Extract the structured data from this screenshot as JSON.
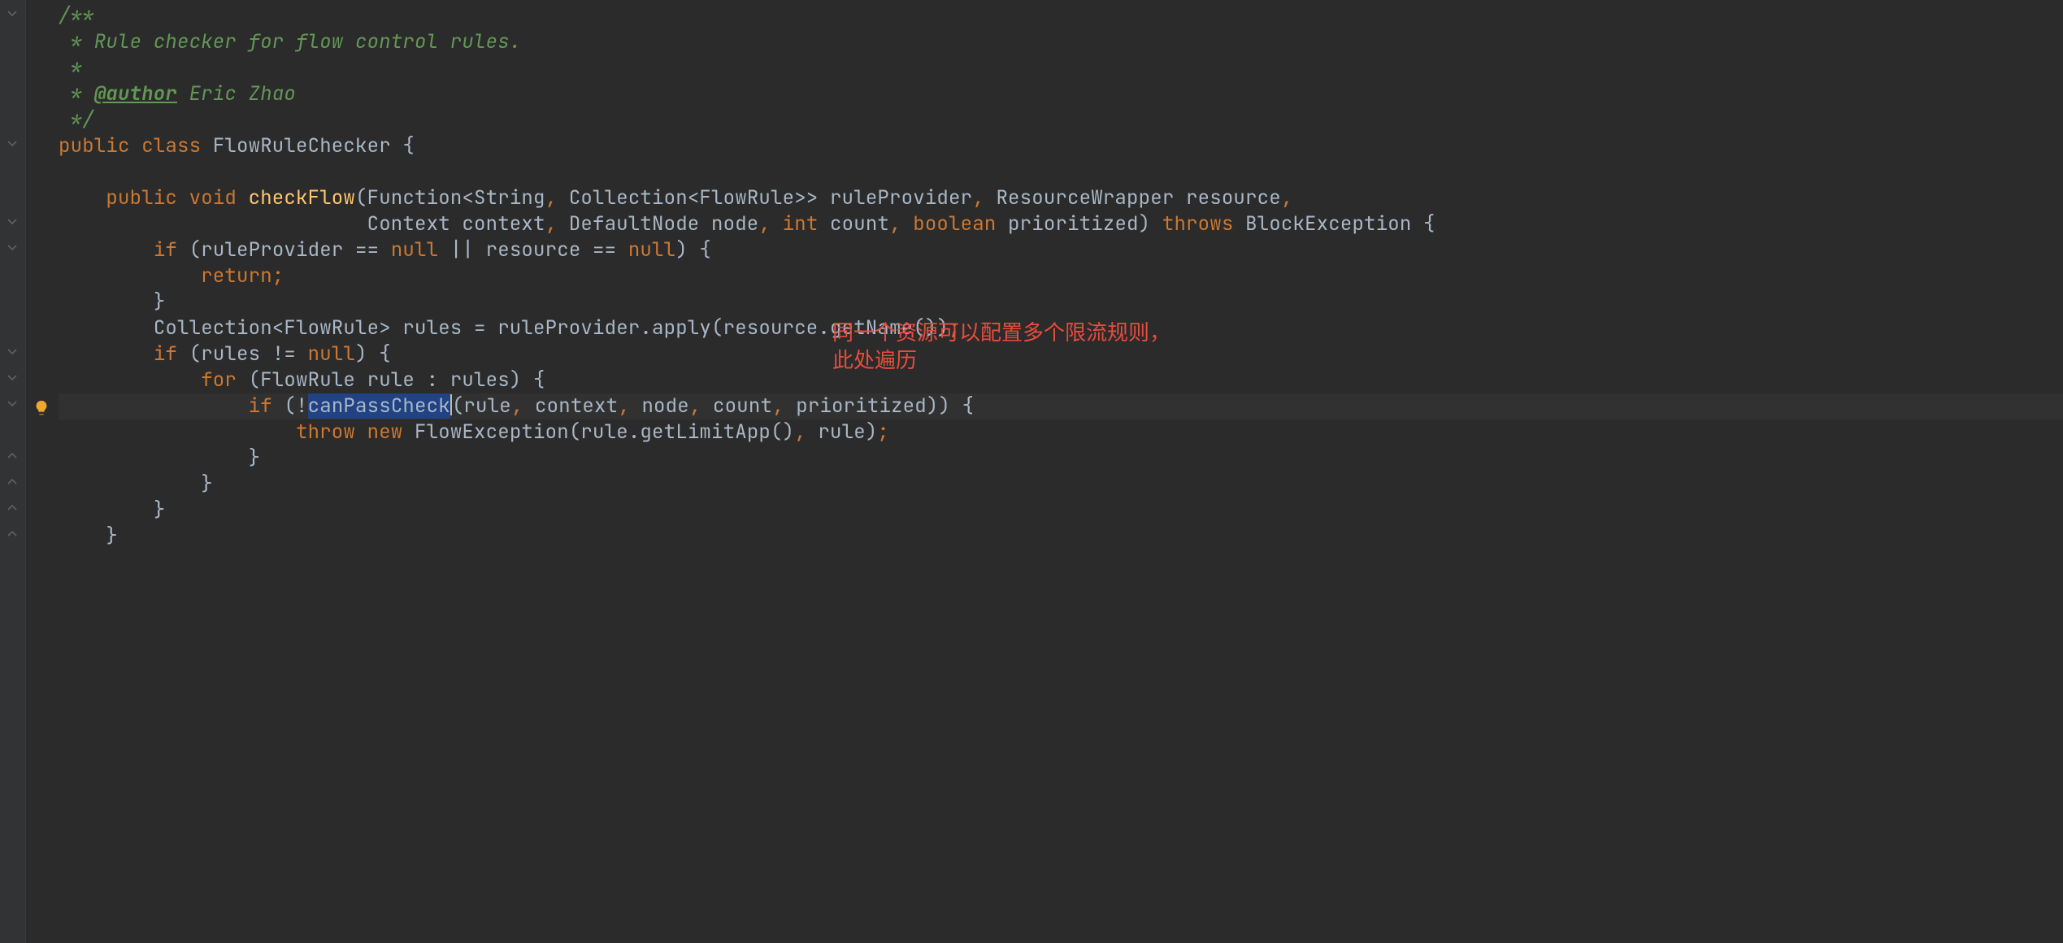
{
  "code": {
    "l1": "/**",
    "l2": " * Rule checker for flow control rules.",
    "l3": " *",
    "l4_pre": " * ",
    "l4_tag": "@author",
    "l4_post": " Eric Zhao",
    "l5": " */",
    "l6_kw1": "public ",
    "l6_kw2": "class ",
    "l6_name": "FlowRuleChecker ",
    "l6_brace": "{",
    "l7": "",
    "l8_ind": "    ",
    "l8_kw1": "public ",
    "l8_kw2": "void ",
    "l8_meth": "checkFlow",
    "l8_sig": "(Function<String",
    "l8_c1": ", ",
    "l8_sig2": "Collection<FlowRule>> ruleProvider",
    "l8_c2": ", ",
    "l8_sig3": "ResourceWrapper resource",
    "l8_c3": ",",
    "l9_ind": "                          ",
    "l9_a": "Context context",
    "l9_c1": ", ",
    "l9_b": "DefaultNode node",
    "l9_c2": ", ",
    "l9_kw1": "int ",
    "l9_c": "count",
    "l9_c3": ", ",
    "l9_kw2": "boolean ",
    "l9_d": "prioritized) ",
    "l9_kw3": "throws ",
    "l9_e": "BlockException {",
    "l10_ind": "        ",
    "l10_kw": "if ",
    "l10_a": "(ruleProvider == ",
    "l10_kw2": "null ",
    "l10_b": "|| resource == ",
    "l10_kw3": "null",
    "l10_c": ") {",
    "l11_ind": "            ",
    "l11_kw": "return;",
    "l12_ind": "        ",
    "l12_a": "}",
    "l13_ind": "        ",
    "l13_a": "Collection<FlowRule> rules = ruleProvider.apply(resource.getName())",
    "l13_semi": ";",
    "l14_ind": "        ",
    "l14_kw": "if ",
    "l14_a": "(rules != ",
    "l14_kw2": "null",
    "l14_b": ") {",
    "l15_ind": "            ",
    "l15_kw": "for ",
    "l15_a": "(FlowRule rule : rules) {",
    "l16_ind": "                ",
    "l16_kw": "if ",
    "l16_a": "(!",
    "l16_sel": "canPassCheck",
    "l16_b": "(rule",
    "l16_c1": ", ",
    "l16_c": "context",
    "l16_c2": ", ",
    "l16_d": "node",
    "l16_c3": ", ",
    "l16_e": "count",
    "l16_c4": ", ",
    "l16_f": "prioritized)) {",
    "l17_ind": "                    ",
    "l17_kw1": "throw ",
    "l17_kw2": "new ",
    "l17_a": "FlowException(rule.getLimitApp()",
    "l17_c1": ", ",
    "l17_b": "rule)",
    "l17_semi": ";",
    "l18_ind": "                ",
    "l18_a": "}",
    "l19_ind": "            ",
    "l19_a": "}",
    "l20_ind": "        ",
    "l20_a": "}",
    "l21_ind": "    ",
    "l21_a": "}"
  },
  "annotation": {
    "line1": "同一个资源可以配置多个限流规则，",
    "line2": "此处遍历"
  },
  "icons": {
    "fold": "fold-toggle-icon",
    "bulb": "intention-bulb-icon"
  }
}
